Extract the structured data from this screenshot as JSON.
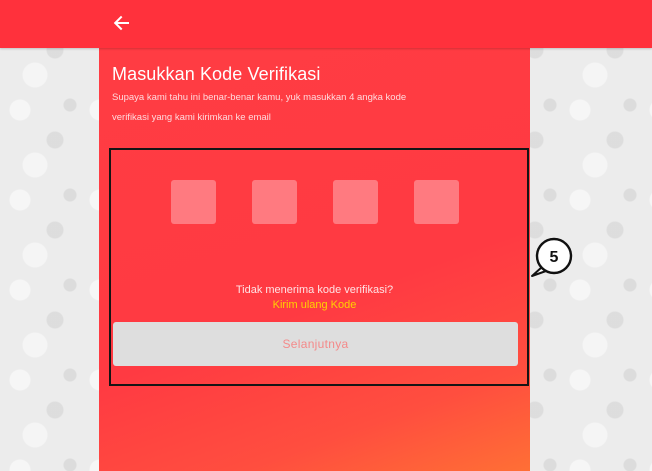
{
  "app": {
    "accent_color": "#ff313c",
    "panel_gradient_end": "#ff6f35"
  },
  "header": {
    "back_icon": "arrow-left-icon"
  },
  "verification": {
    "title": "Masukkan Kode Verifikasi",
    "subtitle": "Supaya kami tahu ini benar-benar kamu, yuk masukkan 4 angka kode verifikasi yang kami kirimkan ke email",
    "code_boxes": [
      "",
      "",
      "",
      ""
    ],
    "resend_prompt": "Tidak menerima kode verifikasi?",
    "resend_link": "Kirim ulang Kode",
    "next_button_label": "Selanjutnya"
  },
  "annotation": {
    "callout_label": "5",
    "highlight_color": "#151515"
  }
}
